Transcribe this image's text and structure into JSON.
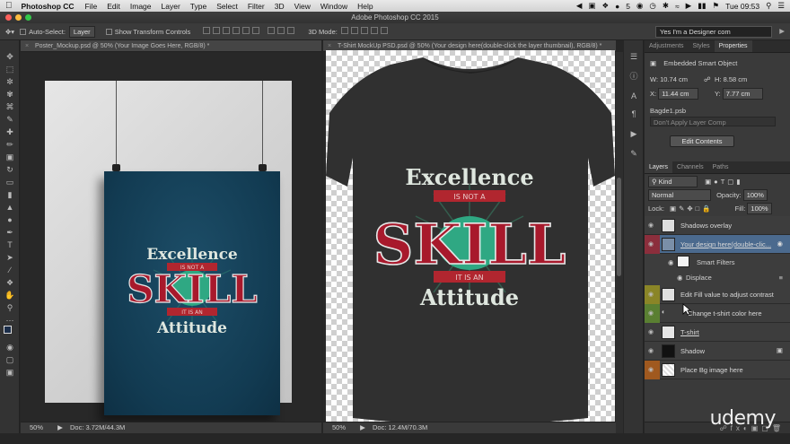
{
  "menubar": {
    "app": "Photoshop CC",
    "items": [
      "File",
      "Edit",
      "Image",
      "Layer",
      "Type",
      "Select",
      "Filter",
      "3D",
      "View",
      "Window",
      "Help"
    ],
    "status_number": "5",
    "clock": "Tue 09:53"
  },
  "window": {
    "title": "Adobe Photoshop CC 2015"
  },
  "options": {
    "auto_select_label": "Auto-Select:",
    "auto_select_value": "Layer",
    "transform_label": "Show Transform Controls",
    "mode_3d": "3D Mode:",
    "workspace": "Yes I'm a Designer com"
  },
  "doc1": {
    "tab": "Poster_Mockup.psd @ 50% (Your Image Goes Here, RGB/8) *",
    "zoom": "50%",
    "doc_size": "Doc: 3.72M/44.3M"
  },
  "doc2": {
    "tab": "T-Shirt MockUp PSD.psd @ 50% (Your design here(double-click the layer thumbnail), RGB/8) *",
    "zoom": "50%",
    "doc_size": "Doc: 12.4M/70.3M"
  },
  "artwork": {
    "line1": "Excellence",
    "ribbon1": "IS NOT A",
    "main": "SKILL",
    "ribbon2": "IT IS AN",
    "line2": "Attitude"
  },
  "properties": {
    "tabs": [
      "Adjustments",
      "Styles",
      "Properties"
    ],
    "type": "Embedded Smart Object",
    "w_label": "W:",
    "w": "10.74 cm",
    "h_label": "H:",
    "h": "8.58 cm",
    "x_label": "X:",
    "x": "11.44 cm",
    "y_label": "Y:",
    "y": "7.77 cm",
    "file": "Bagde1.psb",
    "layer_comp": "Don't Apply Layer Comp",
    "edit_button": "Edit Contents"
  },
  "layers_panel": {
    "tabs": [
      "Layers",
      "Channels",
      "Paths"
    ],
    "filter": "Kind",
    "blend": "Normal",
    "opacity_label": "Opacity:",
    "opacity": "100%",
    "lock_label": "Lock:",
    "fill_label": "Fill:",
    "fill": "100%",
    "layers": [
      {
        "name": "Shadows overlay",
        "color": ""
      },
      {
        "name": "Your design here(double-clic...",
        "color": "#8b2e3c"
      },
      {
        "name": "Edit Fill value to adjust contrast",
        "color": "#8a8527"
      },
      {
        "name": "Change t-shirt color here",
        "color": "#5a7f32"
      },
      {
        "name": "T-shirt",
        "color": ""
      },
      {
        "name": "Shadow",
        "color": ""
      },
      {
        "name": "Place Bg image here",
        "color": "#a0591f"
      }
    ],
    "smart_filters": "Smart Filters",
    "displace": "Displace"
  },
  "watermark": "udemy",
  "colors": {
    "accent_select": "#4b6a8e",
    "shirt": "#303030",
    "poster": "#123b52"
  }
}
